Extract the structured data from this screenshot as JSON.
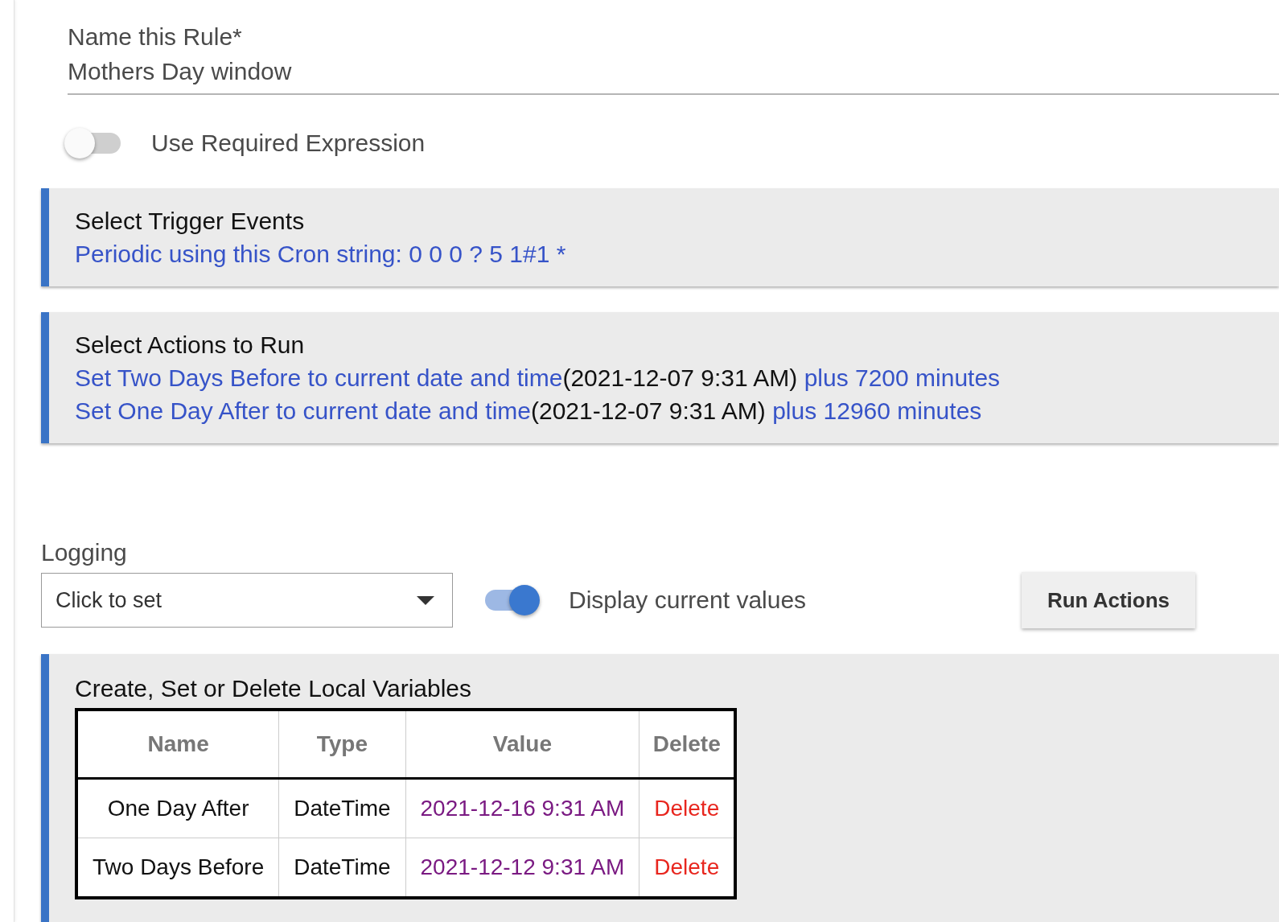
{
  "rule_name": {
    "label": "Name this Rule*",
    "value": "Mothers Day window"
  },
  "required_expression": {
    "label": "Use Required Expression",
    "on": false
  },
  "trigger_section": {
    "title": "Select Trigger Events",
    "items": [
      "Periodic using this Cron string: 0 0 0 ? 5 1#1 *"
    ]
  },
  "actions_section": {
    "title": "Select Actions to Run",
    "items": [
      {
        "link": "Set Two Days Before to current date and time",
        "value": "(2021-12-07 9:31 AM)",
        "suffix": "plus 7200 minutes"
      },
      {
        "link": "Set One Day After to current date and time",
        "value": "(2021-12-07 9:31 AM)",
        "suffix": "plus 12960 minutes"
      }
    ]
  },
  "logging": {
    "label": "Logging",
    "placeholder": "Click to set"
  },
  "display_values": {
    "label": "Display current values",
    "on": true
  },
  "run_actions_button": "Run Actions",
  "variables_section": {
    "title": "Create, Set or Delete Local Variables",
    "columns": [
      "Name",
      "Type",
      "Value",
      "Delete"
    ],
    "rows": [
      {
        "name": "One Day After",
        "type": "DateTime",
        "value": "2021-12-16 9:31 AM",
        "delete": "Delete"
      },
      {
        "name": "Two Days Before",
        "type": "DateTime",
        "value": "2021-12-12 9:31 AM",
        "delete": "Delete"
      }
    ]
  }
}
